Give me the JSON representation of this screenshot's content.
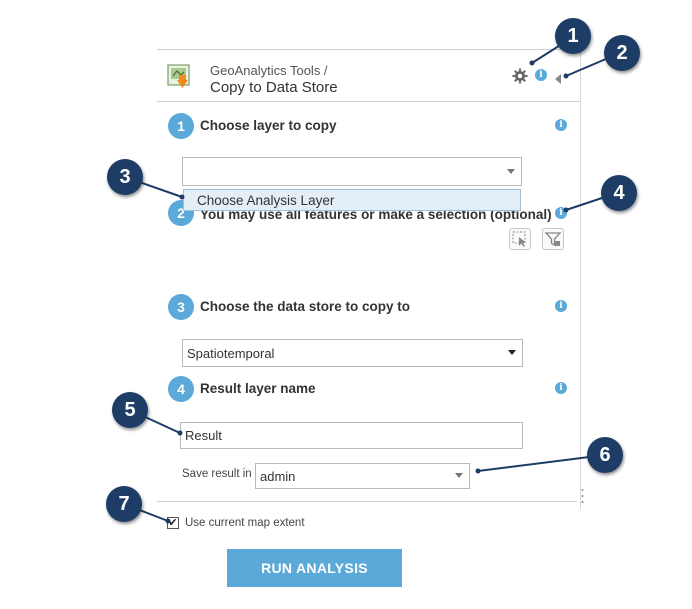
{
  "header": {
    "breadcrumb": "GeoAnalytics Tools /",
    "title": "Copy to Data Store"
  },
  "steps": [
    {
      "number": "1",
      "label": "Choose layer to copy"
    },
    {
      "number": "2",
      "label": "You may use all features or make a selection (optional)"
    },
    {
      "number": "3",
      "label": "Choose the data store to copy to"
    },
    {
      "number": "4",
      "label": "Result layer name"
    }
  ],
  "info_glyph": "i",
  "layer_select": {
    "value": "",
    "open_option": "Choose Analysis Layer"
  },
  "datastore_select": {
    "value": "Spatiotemporal"
  },
  "result_name": {
    "value": "Result"
  },
  "save_in": {
    "label": "Save result in",
    "value": "admin"
  },
  "extent": {
    "label": "Use current map extent",
    "checked_mark": "✔"
  },
  "run_button": "RUN ANALYSIS",
  "callouts": [
    "1",
    "2",
    "3",
    "4",
    "5",
    "6",
    "7"
  ],
  "colors": {
    "accent": "#5aa9d9",
    "callout": "#1d3d67"
  }
}
